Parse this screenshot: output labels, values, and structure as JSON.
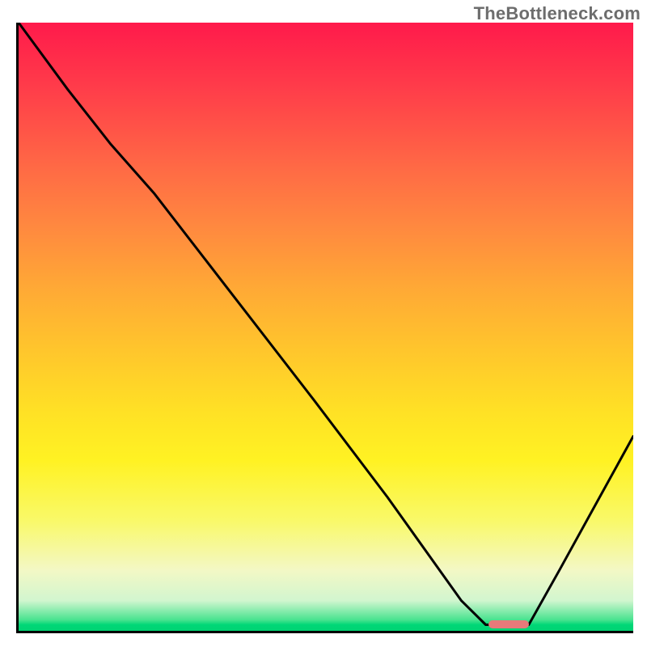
{
  "watermark": "TheBottleneck.com",
  "colors": {
    "gradient_top": "#ff1a4b",
    "gradient_mid1": "#ff8a3f",
    "gradient_mid2": "#ffe125",
    "gradient_bottom": "#00d272",
    "axis": "#000000",
    "curve": "#000000",
    "marker": "#e77a7a",
    "watermark_text": "#6d6d6d"
  },
  "chart_data": {
    "type": "line",
    "title": "",
    "xlabel": "",
    "ylabel": "",
    "xlim": [
      0,
      100
    ],
    "ylim": [
      0,
      100
    ],
    "notes": "Vertical gradient background red→orange→yellow→green. Black V-shaped bottleneck curve. Small pink marker at the valley floor.",
    "series": [
      {
        "name": "bottleneck-curve",
        "x": [
          0,
          8,
          15,
          22,
          35,
          48,
          60,
          72,
          76,
          80,
          83,
          88,
          100
        ],
        "values": [
          100,
          89,
          80,
          72,
          55,
          38,
          22,
          5,
          1,
          1,
          1,
          10,
          32
        ]
      }
    ],
    "marker": {
      "name": "optimal-range",
      "x_start": 76.5,
      "x_end": 83,
      "y": 1
    }
  }
}
